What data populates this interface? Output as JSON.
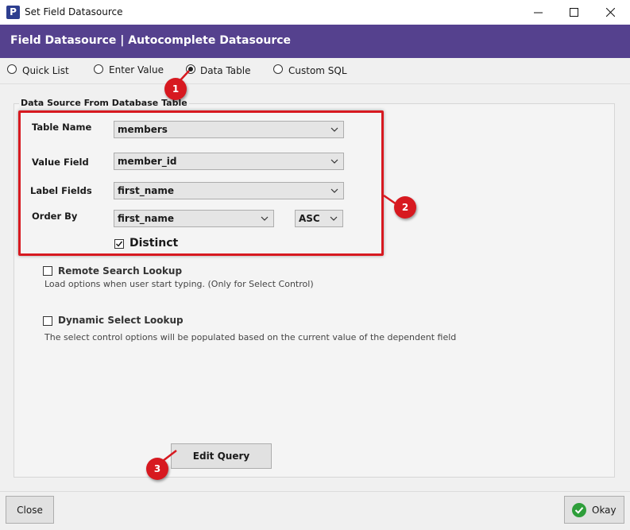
{
  "window": {
    "title": "Set Field Datasource",
    "app_icon_letter": "P",
    "controls": [
      "minimize-icon",
      "maximize-icon",
      "close-icon"
    ]
  },
  "header": {
    "title": "Field Datasource | Autocomplete Datasource",
    "bg_color": "#55418e"
  },
  "source_options": [
    {
      "label": "Quick List",
      "selected": false
    },
    {
      "label": "Enter Value",
      "selected": false
    },
    {
      "label": "Data Table",
      "selected": true
    },
    {
      "label": "Custom SQL",
      "selected": false
    }
  ],
  "group": {
    "title": "Data Source From Database Table",
    "table_name": {
      "label": "Table Name",
      "value": "members"
    },
    "value_field": {
      "label": "Value Field",
      "value": "member_id"
    },
    "label_fields": {
      "label": "Label Fields",
      "value": "first_name"
    },
    "order_by": {
      "label": "Order By",
      "value": "first_name",
      "direction": "ASC"
    },
    "distinct": {
      "label": "Distinct",
      "checked": true
    },
    "remote_search": {
      "label": "Remote Search Lookup",
      "checked": false,
      "description": "Load options when user start typing. (Only for Select Control)"
    },
    "dynamic_select": {
      "label": "Dynamic Select Lookup",
      "checked": false,
      "description": "The select control options will be populated based on the current value of the dependent field"
    },
    "edit_query_label": "Edit Query"
  },
  "annotations": {
    "badge1": "1",
    "badge2": "2",
    "badge3": "3",
    "color": "#d71920"
  },
  "footer": {
    "close_label": "Close",
    "okay_label": "Okay",
    "okay_icon_color": "#2e9e3a"
  }
}
